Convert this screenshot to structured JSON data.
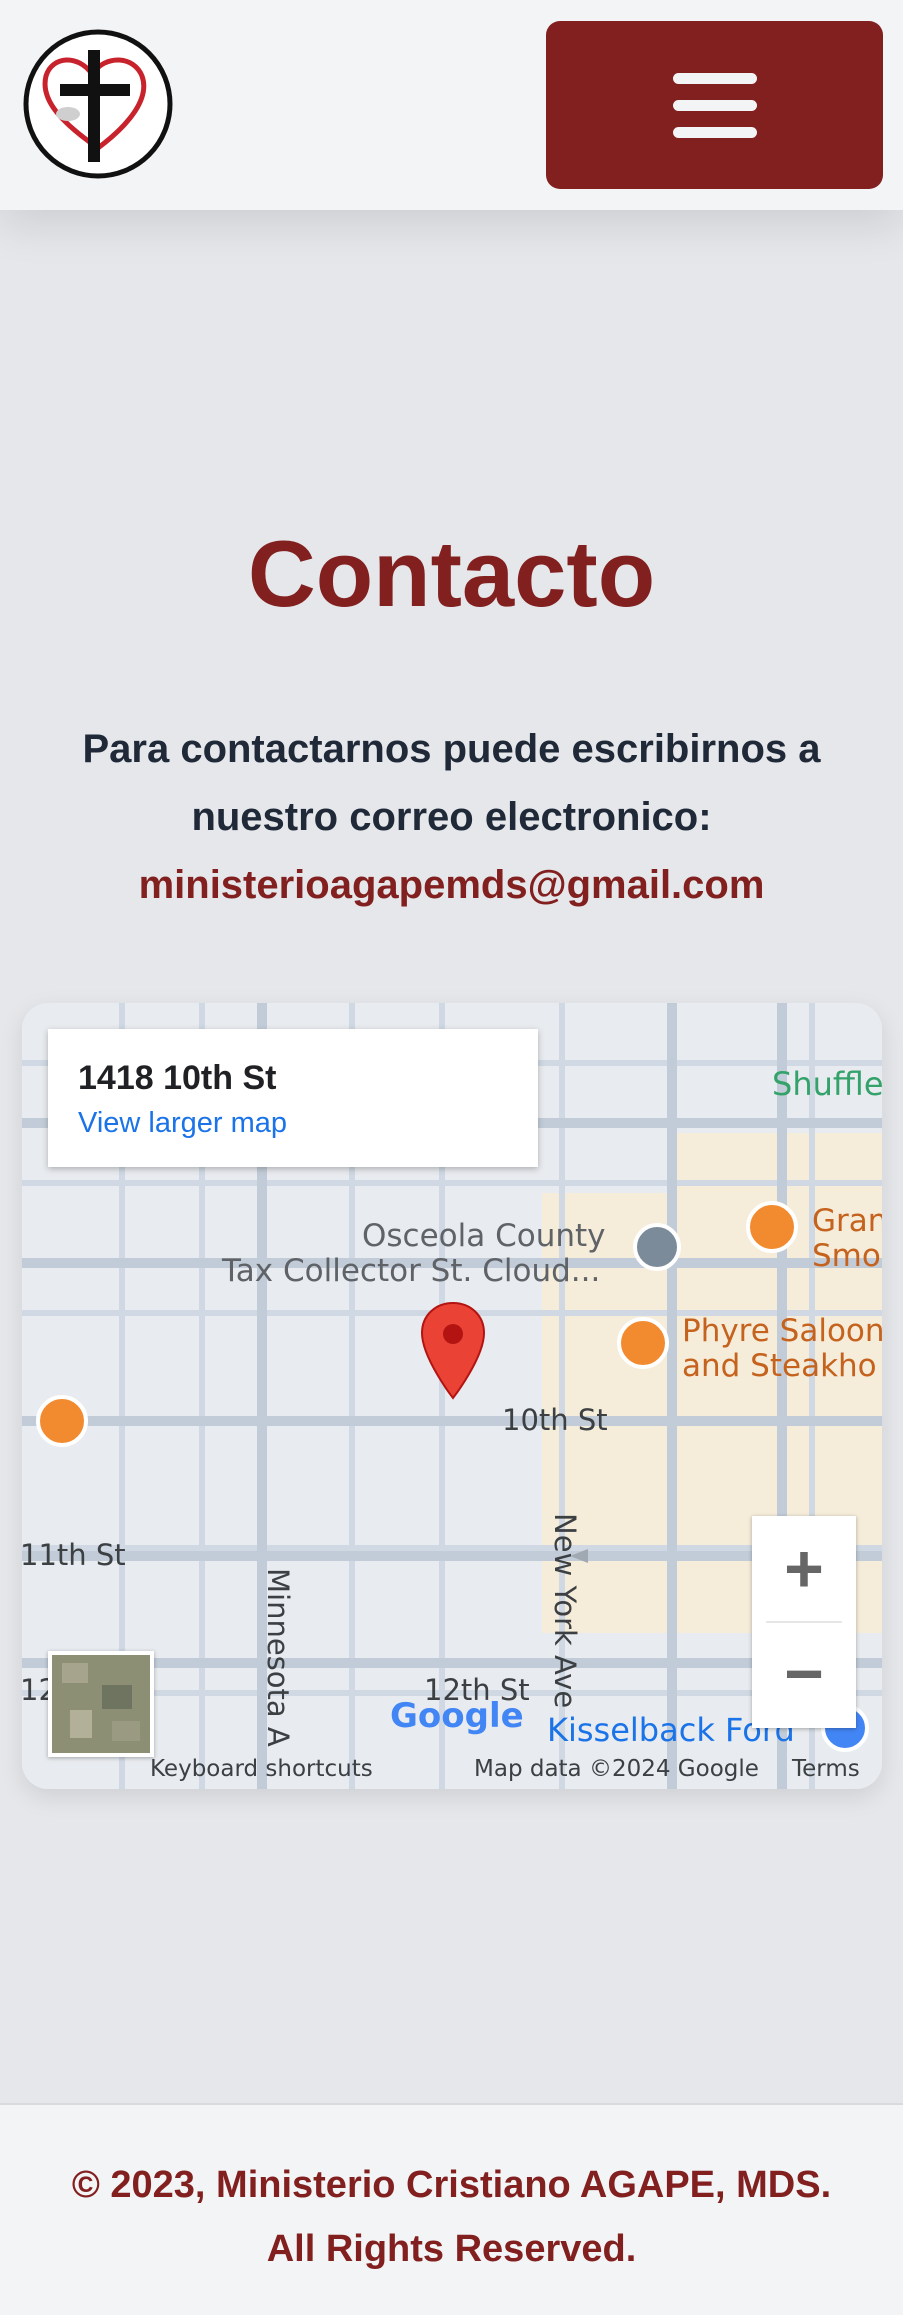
{
  "header": {
    "logo_name": "ministry-logo",
    "menu_label": "menu"
  },
  "main": {
    "title": "Contacto",
    "intro_line1": "Para contactarnos puede escribirnos a",
    "intro_line2": "nuestro correo electronico:",
    "email": "ministerioagapemds@gmail.com"
  },
  "map": {
    "place_name": "1418 10th St",
    "view_larger": "View larger map",
    "labels": {
      "shuffle": "Shuffle",
      "osceola1": "Osceola County",
      "osceola2": "Tax Collector St. Cloud...",
      "gran1": "Gran",
      "gran2": "Smo",
      "phyre1": "Phyre Saloon",
      "phyre2": "and Steakho",
      "tenth": "10th St",
      "eleventh": "11th St",
      "twelfth": "12th St",
      "newyork": "New York Ave",
      "minnesota": "Minnesota A",
      "kisselback": "Kisselback Ford",
      "left12": "12",
      "google": "Google"
    },
    "zoom_in": "+",
    "zoom_out": "−",
    "attribution": {
      "shortcuts": "Keyboard shortcuts",
      "data": "Map data ©2024 Google",
      "terms": "Terms"
    },
    "colors": {
      "pin": "#ea4335",
      "poi": "#f28b30",
      "road": "#c9d3df"
    }
  },
  "footer": {
    "line1": "© 2023, Ministerio Cristiano AGAPE, MDS.",
    "line2": "All Rights Reserved."
  },
  "colors": {
    "brand": "#82201f",
    "text": "#1f2937",
    "background": "#e5e7eb"
  }
}
